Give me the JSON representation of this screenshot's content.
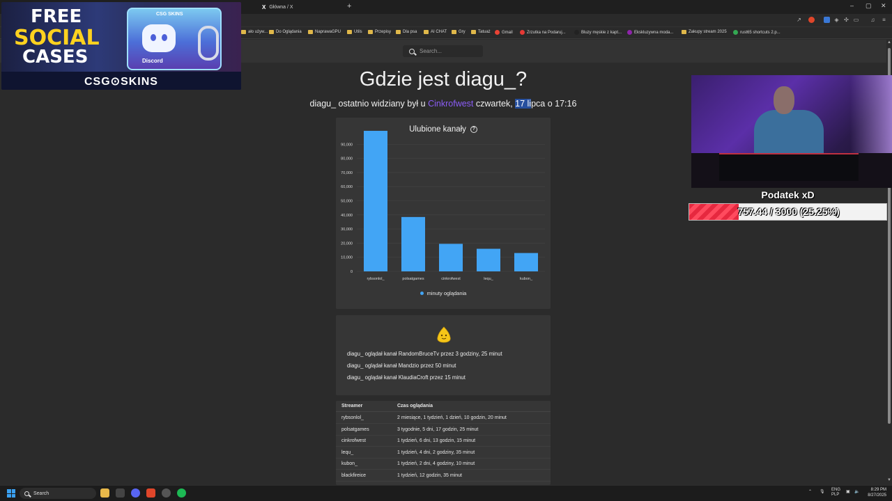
{
  "browser": {
    "tab_title": "Główna / X",
    "new_tab": "+",
    "window_controls": [
      "–",
      "▢",
      "✕"
    ],
    "bookmarks": [
      {
        "label": "ało używ...",
        "icon": "folder"
      },
      {
        "label": "Do Oglądania",
        "icon": "folder"
      },
      {
        "label": "NaprawaGPU",
        "icon": "folder"
      },
      {
        "label": "Utils",
        "icon": "folder"
      },
      {
        "label": "Przepisy",
        "icon": "folder"
      },
      {
        "label": "Dla psa",
        "icon": "folder"
      },
      {
        "label": "AI CHAT",
        "icon": "folder"
      },
      {
        "label": "Gry",
        "icon": "folder"
      },
      {
        "label": "Tatuaż",
        "icon": "folder"
      },
      {
        "label": "Gmail",
        "icon": "gmail-icon"
      },
      {
        "label": "Zrzutka na Podaruj...",
        "icon": "zrzutka-icon"
      },
      {
        "label": "Bluzy męskie z kapt...",
        "icon": "shop-icon"
      },
      {
        "label": "Ekskluzywna moda...",
        "icon": "fashion-icon"
      },
      {
        "label": "Zakupy stream 2025",
        "icon": "folder"
      },
      {
        "label": "rust65 shortcuts 2.p...",
        "icon": "drive-icon"
      }
    ]
  },
  "site": {
    "search_placeholder": "Search..."
  },
  "main": {
    "title": "Gdzie jest diagu_?",
    "subtitle_pre": "diagu_ ostatnio widziany był u ",
    "subtitle_channel": "Cinkrofwest",
    "subtitle_mid": " czwartek, ",
    "subtitle_selected": "17 li",
    "subtitle_post": "pca o 17:16"
  },
  "favorites": {
    "title": "Ulubione kanały",
    "help_glyph": "?"
  },
  "chart_data": {
    "type": "bar",
    "categories": [
      "rybsonlol_",
      "polsatgames",
      "cinkrofwest",
      "lequ_",
      "kubon_"
    ],
    "series": [
      {
        "name": "minuty oglądania",
        "values": [
          99500,
          38500,
          19500,
          16000,
          13000
        ],
        "color": "#42a5f5"
      }
    ],
    "ylim": [
      0,
      100000
    ],
    "yticks": [
      0,
      10000,
      20000,
      30000,
      40000,
      50000,
      60000,
      70000,
      80000,
      90000
    ],
    "ytick_labels": [
      "0",
      "10,000",
      "20,000",
      "30,000",
      "40,000",
      "50,000",
      "60,000",
      "70,000",
      "80,000",
      "90,000"
    ],
    "grid": true,
    "legend_position": "bottom"
  },
  "recent": {
    "icon": "hands-emoji-icon",
    "lines": [
      "diagu_ oglądał kanał RandomBruceTv przez 3 godziny, 25 minut",
      "diagu_ oglądał kanał Mandzio przez 50 minut",
      "diagu_ oglądał kanał KlaudiaCroft przez 15 minut"
    ]
  },
  "table": {
    "headers": [
      "Streamer",
      "Czas oglądania"
    ],
    "rows": [
      [
        "rybsonlol_",
        "2 miesiące, 1 tydzień, 1 dzień, 10 godzin, 20 minut"
      ],
      [
        "polsatgames",
        "3 tygodnie, 5 dni, 17 godzin, 25 minut"
      ],
      [
        "cinkrofwest",
        "1 tydzień, 6 dni, 13 godzin, 15 minut"
      ],
      [
        "lequ_",
        "1 tydzień, 4 dni, 2 godziny, 35 minut"
      ],
      [
        "kubon_",
        "1 tydzień, 2 dni, 4 godziny, 10 minut"
      ],
      [
        "blackfireice",
        "1 tydzień, 12 godzin, 35 minut"
      ]
    ]
  },
  "overlay": {
    "promo_line1": "FREE",
    "promo_line2": "SOCIAL",
    "promo_line3": "CASES",
    "promo_brand": "CSG⊙SKINS",
    "case_tag": "CSG SKINS",
    "case_label": "Discord",
    "goal_title": "Podatek xD",
    "goal_text": "757.44 / 3000 (25.25%)",
    "goal_fraction": 0.2525
  },
  "taskbar": {
    "search_label": "Search",
    "lang_top": "ENG",
    "lang_bottom": "PLP",
    "time": "8:29 PM",
    "date": "8/27/2025"
  }
}
